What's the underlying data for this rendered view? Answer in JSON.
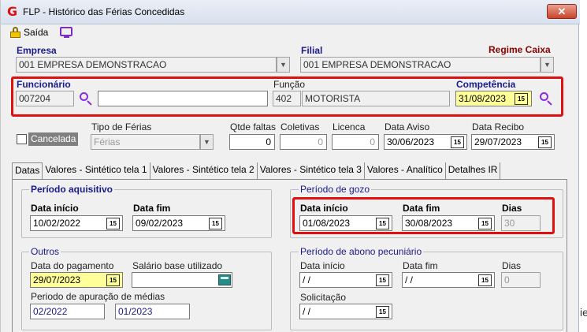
{
  "window": {
    "title": "FLP - Histórico das Férias Concedidas",
    "close_label": "✕"
  },
  "toolbar": {
    "exit_label": "Saída"
  },
  "header": {
    "empresa_label": "Empresa",
    "empresa_value": "001 EMPRESA DEMONSTRACAO",
    "filial_label": "Filial",
    "filial_value": "001 EMPRESA DEMONSTRACAO",
    "regime_label": "Regime Caixa"
  },
  "employee": {
    "funcionario_label": "Funcionário",
    "funcionario_code": "007204",
    "funcionario_name": "",
    "funcao_label": "Função",
    "funcao_code": "402",
    "funcao_name": "MOTORISTA",
    "competencia_label": "Competência",
    "competencia_value": "31/08/2023"
  },
  "row2": {
    "cancelada_label": "Cancelada",
    "tipo_label": "Tipo de Férias",
    "tipo_value": "Férias",
    "faltas_label": "Qtde faltas",
    "faltas_value": "0",
    "coletivas_label": "Coletivas",
    "coletivas_value": "0",
    "licenca_label": "Licenca",
    "licenca_value": "0",
    "aviso_label": "Data Aviso",
    "aviso_value": "30/06/2023",
    "recibo_label": "Data Recibo",
    "recibo_value": "29/07/2023"
  },
  "tabs": [
    {
      "label": "Datas"
    },
    {
      "label": "Valores - Sintético tela 1"
    },
    {
      "label": "Valores - Sintético tela 2"
    },
    {
      "label": "Valores - Sintético tela 3"
    },
    {
      "label": "Valores - Analítico"
    },
    {
      "label": "Detalhes IR"
    }
  ],
  "aquisitivo": {
    "title": "Período aquisitivo",
    "inicio_label": "Data início",
    "inicio_value": "10/02/2022",
    "fim_label": "Data fim",
    "fim_value": "09/02/2023"
  },
  "gozo": {
    "title": "Período de gozo",
    "inicio_label": "Data início",
    "inicio_value": "01/08/2023",
    "fim_label": "Data fim",
    "fim_value": "30/08/2023",
    "dias_label": "Dias",
    "dias_value": "30"
  },
  "outros": {
    "title": "Outros",
    "pagamento_label": "Data do pagamento",
    "pagamento_value": "29/07/2023",
    "salario_label": "Salário base utilizado",
    "salario_value": "",
    "apuracao_label": "Periodo de apuração de médias",
    "apuracao_inicio": "02/2022",
    "apuracao_fim": "01/2023"
  },
  "abono": {
    "title": "Período de abono pecuniário",
    "inicio_label": "Data início",
    "inicio_value": " /  /",
    "fim_label": "Data fim",
    "fim_value": " /  /",
    "dias_label": "Dias",
    "dias_value": "0",
    "solicitacao_label": "Solicitação",
    "solicitacao_value": " /  /"
  },
  "calendar_glyph": "15",
  "dropdown_glyph": "▼",
  "edge_glyph": "ie",
  "colors": {
    "highlight_red": "#e01010",
    "required_yellow": "#ffff99",
    "label_blue": "#1a1a8c",
    "regime_red": "#8b0000"
  }
}
